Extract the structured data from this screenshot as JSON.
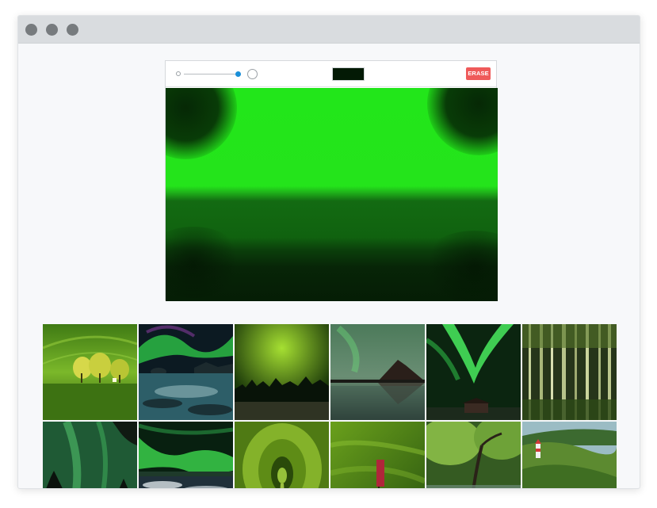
{
  "window": {
    "controls": [
      "close-dot",
      "minimize-dot",
      "maximize-dot"
    ]
  },
  "editor": {
    "toolbar": {
      "brush_size": 1.0,
      "color": "#031a05",
      "erase_label": "ERASE",
      "erase_color": "#ef5a5a"
    },
    "canvas": {
      "accent": "#24e41b",
      "dark": "#051d05"
    }
  },
  "gallery": {
    "thumbnails": [
      {
        "subject": "trees-in-green-field"
      },
      {
        "subject": "aurora-over-rocky-coast"
      },
      {
        "subject": "aurora-over-treeline"
      },
      {
        "subject": "aurora-over-mountain-lake"
      },
      {
        "subject": "aurora-swirl-over-cabin"
      },
      {
        "subject": "bamboo-forest"
      },
      {
        "subject": "aurora-over-silhouettes"
      },
      {
        "subject": "aurora-over-snowy-shore"
      },
      {
        "subject": "green-tree-tunnel"
      },
      {
        "subject": "green-grass-with-sign"
      },
      {
        "subject": "green-forest-stream"
      },
      {
        "subject": "green-hills-with-lighthouse"
      }
    ]
  }
}
